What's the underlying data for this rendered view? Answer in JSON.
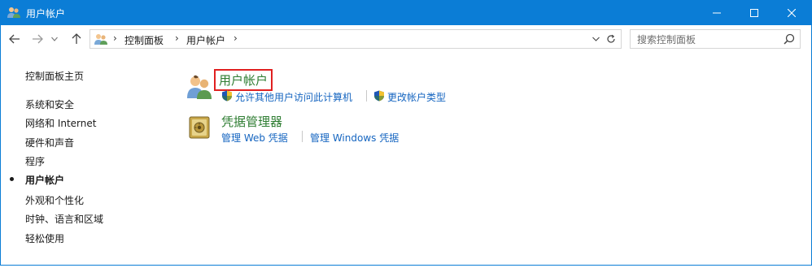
{
  "window": {
    "title": "用户帐户",
    "controls": {
      "minimize": "—",
      "maximize": "☐",
      "close": "✕"
    },
    "accent": "#0b7dd6"
  },
  "nav": {
    "back_icon": "←",
    "forward_icon": "→",
    "history_icon": "⌄",
    "up_icon": "↑"
  },
  "address": {
    "separator": "›",
    "crumbs": [
      "控制面板",
      "用户帐户"
    ],
    "dropdown_icon": "⌄",
    "refresh_icon": "↻"
  },
  "search": {
    "placeholder": "搜索控制面板"
  },
  "sidebar": {
    "items": [
      {
        "label": "控制面板主页",
        "active": false
      },
      {
        "label": "系统和安全",
        "active": false
      },
      {
        "label": "网络和 Internet",
        "active": false
      },
      {
        "label": "硬件和声音",
        "active": false
      },
      {
        "label": "程序",
        "active": false
      },
      {
        "label": "用户帐户",
        "active": true
      },
      {
        "label": "外观和个性化",
        "active": false
      },
      {
        "label": "时钟、语言和区域",
        "active": false
      },
      {
        "label": "轻松使用",
        "active": false
      }
    ]
  },
  "categories": [
    {
      "title": "用户帐户",
      "icon": "users-icon",
      "tasks": [
        "允许其他用户访问此计算机",
        "更改帐户类型"
      ]
    },
    {
      "title": "凭据管理器",
      "icon": "vault-icon",
      "tasks": [
        "管理 Web 凭据",
        "管理 Windows 凭据"
      ]
    }
  ],
  "colors": {
    "category_title": "#2e7d32",
    "task_link": "#1565c0",
    "highlight_box": "#e02020"
  }
}
